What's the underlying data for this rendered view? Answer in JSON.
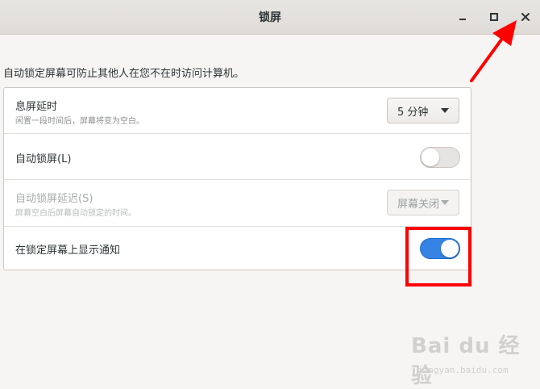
{
  "window": {
    "title": "锁屏"
  },
  "description": "自动锁定屏幕可防止其他人在您不在时访问计算机。",
  "rows": [
    {
      "label": "息屏延时",
      "sublabel": "闲置一段时间后，屏幕将变为空白。",
      "control": "dropdown",
      "value": "5 分钟"
    },
    {
      "label": "自动锁屏(L)",
      "control": "toggle",
      "state": "off"
    },
    {
      "label": "自动锁屏延迟(S)",
      "sublabel": "屏幕空白后屏幕自动锁定的时间。",
      "control": "dropdown",
      "value": "屏幕关闭",
      "disabled": true
    },
    {
      "label": "在锁定屏幕上显示通知",
      "control": "toggle",
      "state": "on"
    }
  ],
  "icons": {
    "minimize": "minimize-icon",
    "maximize": "maximize-icon",
    "close": "close-icon",
    "dropdown_arrow": "chevron-down-icon"
  },
  "watermark": {
    "text": "Bai du 经验",
    "sub": "jingyan.baidu.com"
  },
  "colors": {
    "accent": "#3584e4",
    "annotation": "#ff0000"
  }
}
